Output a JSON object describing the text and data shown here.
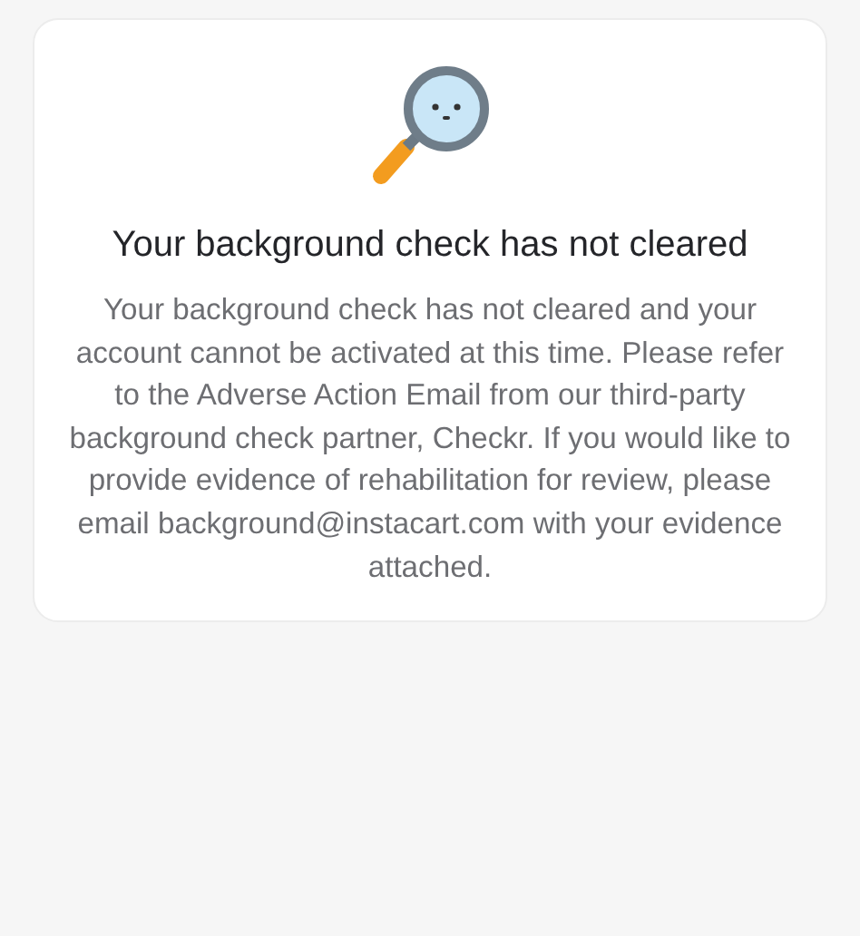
{
  "title": "Your background check has not cleared",
  "message": "Your background check has not cleared and your account cannot be activated at this time. Please refer to the Adverse Action Email from our third-party background check partner, Checkr. If you would like to provide evidence of rehabilitation for review, please email background@instacart.com with your evidence attached."
}
